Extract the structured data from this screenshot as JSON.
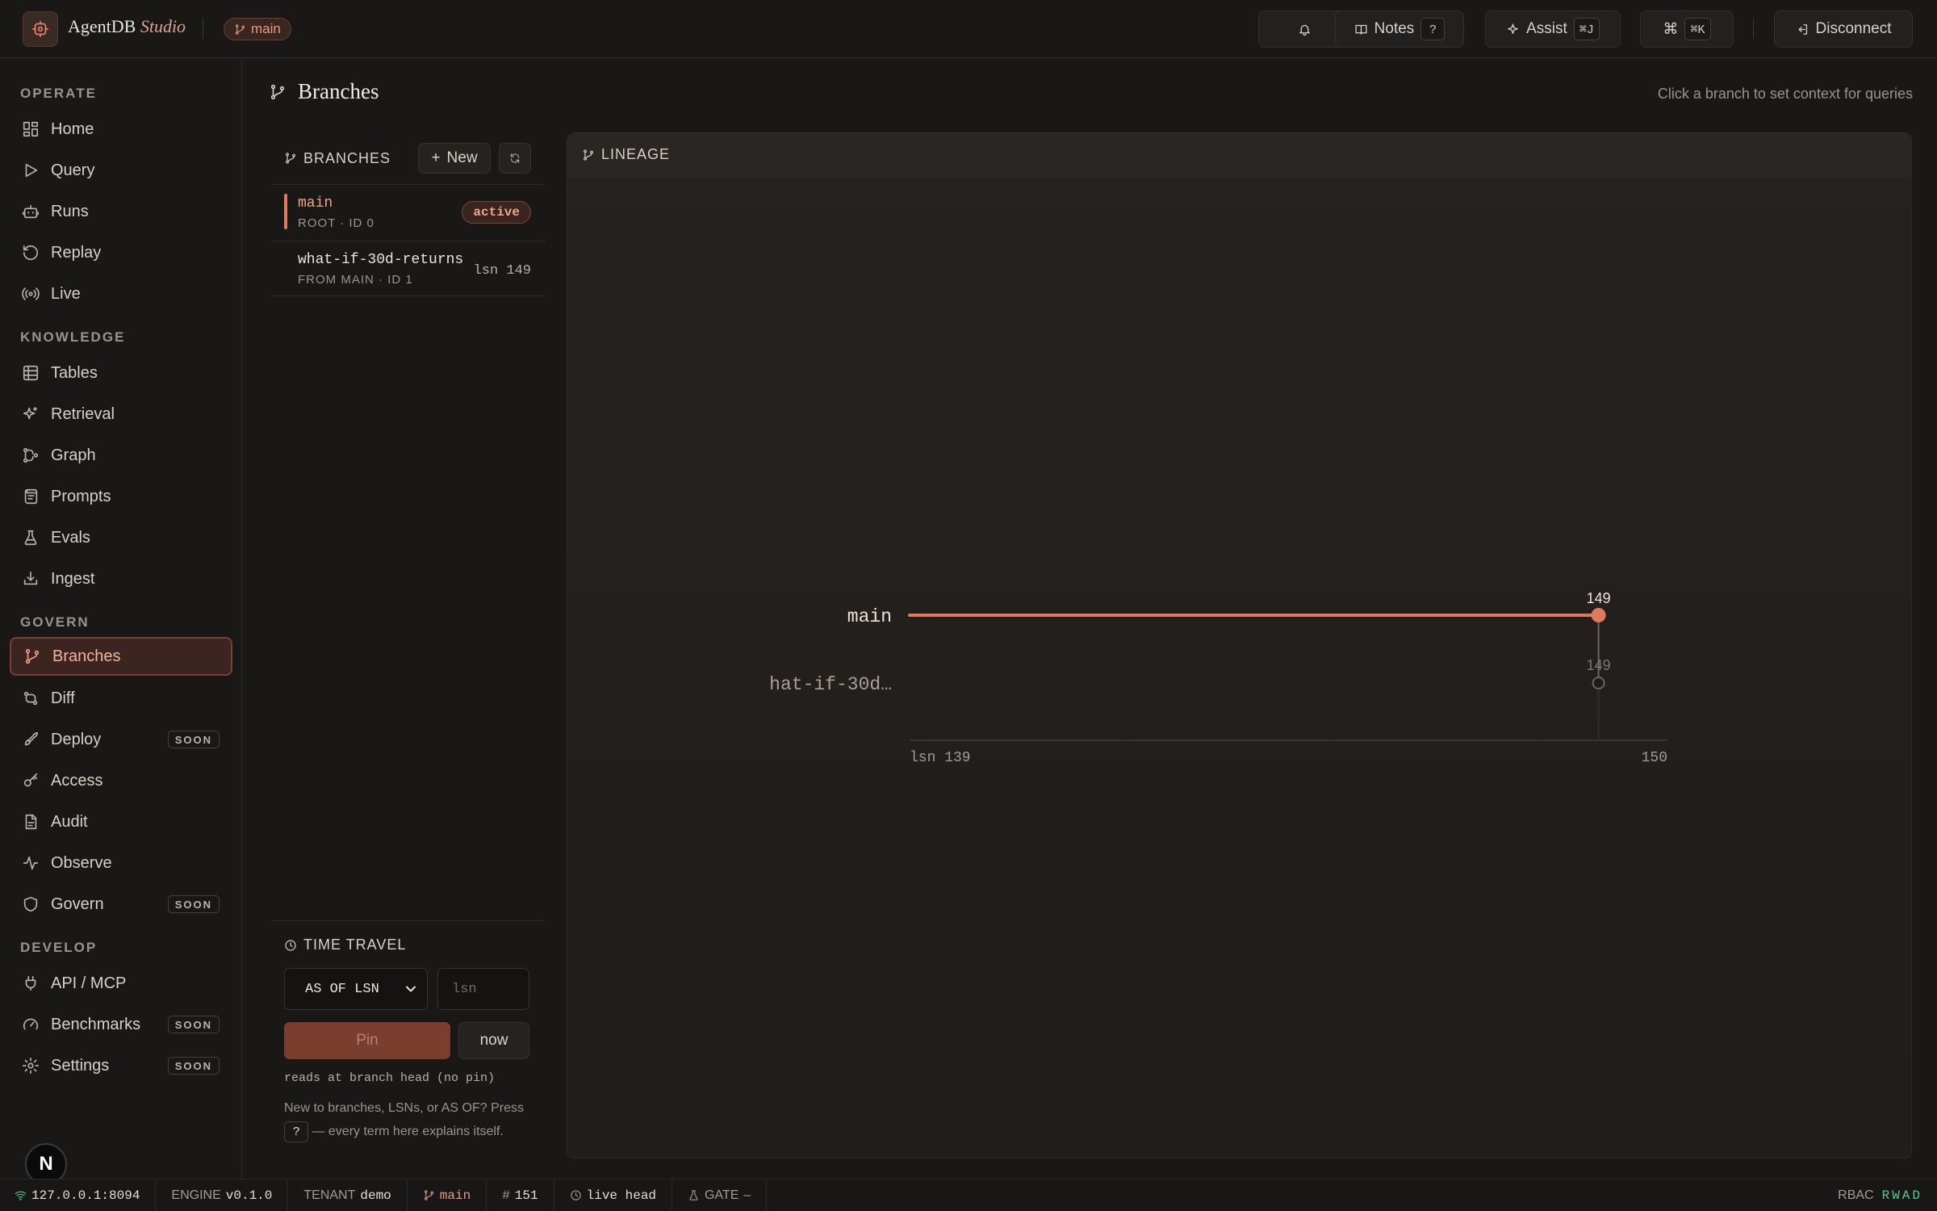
{
  "app": {
    "name": "AgentDB",
    "suffix": "Studio",
    "branch_chip": "main"
  },
  "topbar": {
    "notifications_icon": "bell-icon",
    "notes_label": "Notes",
    "notes_kbd": "?",
    "assist_label": "Assist",
    "assist_kbd": "⌘J",
    "palette_glyph": "⌘",
    "palette_kbd": "⌘K",
    "disconnect_label": "Disconnect"
  },
  "sidebar": {
    "sections": {
      "operate": "OPERATE",
      "knowledge": "KNOWLEDGE",
      "govern": "GOVERN",
      "develop": "DEVELOP"
    },
    "items": {
      "home": "Home",
      "query": "Query",
      "runs": "Runs",
      "replay": "Replay",
      "live": "Live",
      "tables": "Tables",
      "retrieval": "Retrieval",
      "graph": "Graph",
      "prompts": "Prompts",
      "evals": "Evals",
      "ingest": "Ingest",
      "branches": "Branches",
      "diff": "Diff",
      "deploy": "Deploy",
      "access": "Access",
      "audit": "Audit",
      "observe": "Observe",
      "govern": "Govern",
      "api": "API / MCP",
      "benchmarks": "Benchmarks",
      "settings": "Settings"
    },
    "soon_badge": "SOON",
    "active": "branches",
    "avatar_letter": "N"
  },
  "page": {
    "title": "Branches",
    "hint": "Click a branch to set context for queries"
  },
  "branches_panel": {
    "title": "BRANCHES",
    "new_label": "New",
    "rows": [
      {
        "name": "main",
        "sub": "ROOT · ID 0",
        "badge": "active"
      },
      {
        "name": "what-if-30d-returns",
        "sub": "FROM MAIN · ID 1",
        "tag": "lsn 149"
      }
    ]
  },
  "time_travel": {
    "title": "TIME TRAVEL",
    "mode_value": "AS OF LSN",
    "lsn_placeholder": "lsn",
    "pin_label": "Pin",
    "now_label": "now",
    "status_note": "reads at branch head (no pin)",
    "help_before": "New to branches, LSNs, or AS OF? Press",
    "help_kbd": "?",
    "help_after": "— every term here explains itself."
  },
  "lineage": {
    "title": "LINEAGE",
    "colors": {
      "main": "#e07a5a",
      "child": "#6b6561",
      "axis": "#3a3632"
    },
    "chart_data": {
      "type": "line",
      "xlim": [
        139,
        150
      ],
      "x_tick_labels": [
        "lsn 139",
        "150"
      ],
      "series": [
        {
          "name": "main",
          "label": "main",
          "x_start": 139,
          "x_end": 149,
          "point_lsn": 149,
          "point_label": "149"
        },
        {
          "name": "what-if-30d-returns",
          "label": "hat-if-30d…",
          "forked_from": "main",
          "fork_lsn": 149,
          "point_lsn": 149,
          "point_label": "149"
        }
      ]
    }
  },
  "statusbar": {
    "host": "127.0.0.1:8094",
    "engine_label": "ENGINE",
    "engine_value": "v0.1.0",
    "tenant_label": "TENANT",
    "tenant_value": "demo",
    "branch": "main",
    "lsn_count": "151",
    "head": "live head",
    "gate_label": "GATE",
    "gate_value": "–",
    "rbac_label": "RBAC",
    "rbac_value": "RWAD"
  }
}
